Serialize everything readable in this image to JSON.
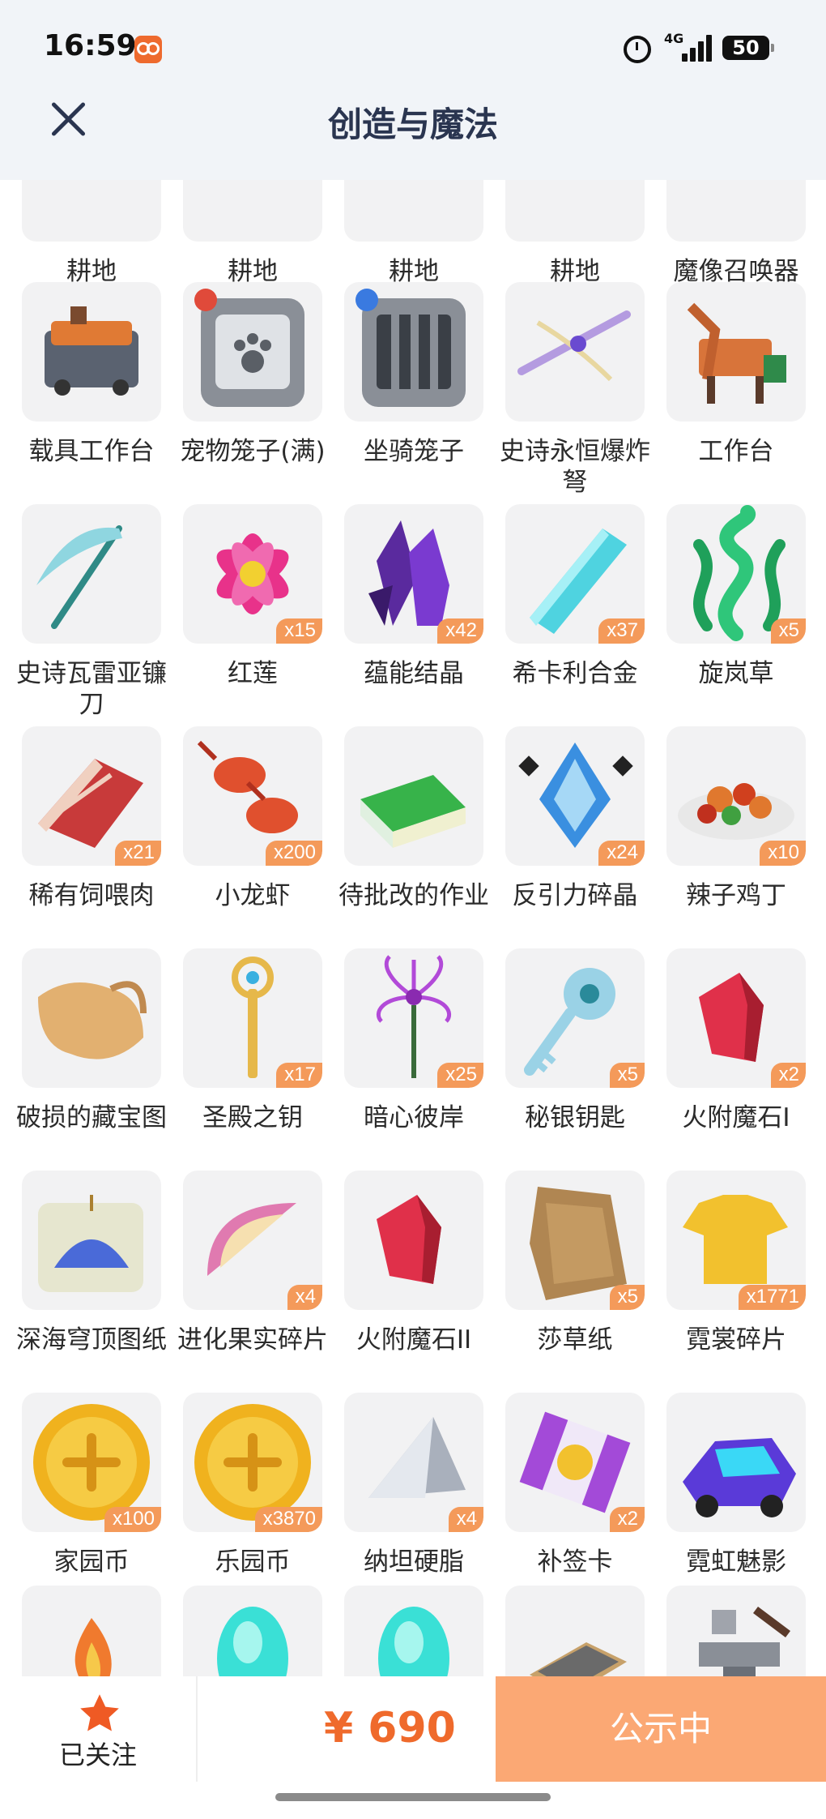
{
  "status_bar": {
    "time": "16:59",
    "network": "4G",
    "battery": "50"
  },
  "header": {
    "title": "创造与魔法"
  },
  "grid": {
    "items": [
      {
        "label": "耕地",
        "count": "",
        "icon": "farmland-icon",
        "color": "#7a4a2e"
      },
      {
        "label": "耕地",
        "count": "",
        "icon": "farmland-icon",
        "color": "#7a4a2e"
      },
      {
        "label": "耕地",
        "count": "",
        "icon": "farmland-icon",
        "color": "#7a4a2e"
      },
      {
        "label": "耕地",
        "count": "",
        "icon": "farmland-icon",
        "color": "#7a4a2e"
      },
      {
        "label": "魔像召唤器",
        "count": "",
        "icon": "golem-summoner-icon",
        "color": "#d8a640"
      },
      {
        "label": "载具工作台",
        "count": "",
        "icon": "vehicle-workbench-icon",
        "color": "#e07a34"
      },
      {
        "label": "宠物笼子(满)",
        "count": "",
        "icon": "pet-cage-icon",
        "color": "#8a8f97"
      },
      {
        "label": "坐骑笼子",
        "count": "",
        "icon": "mount-cage-icon",
        "color": "#8a8f97"
      },
      {
        "label": "史诗永恒爆炸弩",
        "count": "",
        "icon": "crossbow-icon",
        "color": "#b49be0"
      },
      {
        "label": "工作台",
        "count": "",
        "icon": "workbench-icon",
        "color": "#d8743a"
      },
      {
        "label": "史诗瓦雷亚镰刀",
        "count": "",
        "icon": "scythe-icon",
        "color": "#8fd6e0"
      },
      {
        "label": "红莲",
        "count": "x15",
        "icon": "lotus-icon",
        "color": "#e8328a"
      },
      {
        "label": "蕴能结晶",
        "count": "x42",
        "icon": "crystal-icon",
        "color": "#5a2a9e"
      },
      {
        "label": "希卡利合金",
        "count": "x37",
        "icon": "alloy-icon",
        "color": "#4fd3e0"
      },
      {
        "label": "旋岚草",
        "count": "x5",
        "icon": "herb-icon",
        "color": "#2fc67a"
      },
      {
        "label": "稀有饲喂肉",
        "count": "x21",
        "icon": "meat-icon",
        "color": "#c83a3a"
      },
      {
        "label": "小龙虾",
        "count": "x200",
        "icon": "crayfish-icon",
        "color": "#e0502e"
      },
      {
        "label": "待批改的作业",
        "count": "",
        "icon": "homework-icon",
        "color": "#37b34a"
      },
      {
        "label": "反引力碎晶",
        "count": "x24",
        "icon": "antigravity-shard-icon",
        "color": "#3a8fe0"
      },
      {
        "label": "辣子鸡丁",
        "count": "x10",
        "icon": "spicy-chicken-icon",
        "color": "#e0782e"
      },
      {
        "label": "破损的藏宝图",
        "count": "",
        "icon": "treasure-map-icon",
        "color": "#e2b070"
      },
      {
        "label": "圣殿之钥",
        "count": "x17",
        "icon": "temple-key-icon",
        "color": "#e6b84a"
      },
      {
        "label": "暗心彼岸",
        "count": "x25",
        "icon": "spider-lily-icon",
        "color": "#b24ad8"
      },
      {
        "label": "秘银钥匙",
        "count": "x5",
        "icon": "mithril-key-icon",
        "color": "#9ad2e6"
      },
      {
        "label": "火附魔石I",
        "count": "x2",
        "icon": "fire-stone-icon",
        "color": "#e0304a"
      },
      {
        "label": "深海穹顶图纸",
        "count": "",
        "icon": "blueprint-icon",
        "color": "#4a6ad8"
      },
      {
        "label": "进化果实碎片",
        "count": "x4",
        "icon": "fruit-shard-icon",
        "color": "#e07ab0"
      },
      {
        "label": "火附魔石II",
        "count": "",
        "icon": "fire-stone-icon",
        "color": "#e0304a"
      },
      {
        "label": "莎草纸",
        "count": "x5",
        "icon": "papyrus-icon",
        "color": "#b08652"
      },
      {
        "label": "霓裳碎片",
        "count": "x1771",
        "icon": "tshirt-icon",
        "color": "#f2c12e"
      },
      {
        "label": "家园币",
        "count": "x100",
        "icon": "home-coin-icon",
        "color": "#f0b21e"
      },
      {
        "label": "乐园币",
        "count": "x3870",
        "icon": "paradise-coin-icon",
        "color": "#f0b21e"
      },
      {
        "label": "纳坦硬脂",
        "count": "x4",
        "icon": "resin-icon",
        "color": "#a9b0bc"
      },
      {
        "label": "补签卡",
        "count": "x2",
        "icon": "sign-card-icon",
        "color": "#a34ad8"
      },
      {
        "label": "霓虹魅影",
        "count": "",
        "icon": "neon-car-icon",
        "color": "#5a3ad8"
      },
      {
        "label": "",
        "count": "",
        "icon": "campfire-icon",
        "color": "#f07a2e"
      },
      {
        "label": "",
        "count": "",
        "icon": "cyan-gem-icon",
        "color": "#3ae0d6"
      },
      {
        "label": "",
        "count": "",
        "icon": "cyan-gem-icon",
        "color": "#3ae0d6"
      },
      {
        "label": "",
        "count": "",
        "icon": "plate-icon",
        "color": "#6a6a6a"
      },
      {
        "label": "",
        "count": "",
        "icon": "anvil-icon",
        "color": "#8a8f97"
      }
    ]
  },
  "bottom_bar": {
    "follow_label": "已关注",
    "price": "¥ 690",
    "status_button": "公示中"
  },
  "colors": {
    "accent": "#ef6a2c",
    "button": "#fba874",
    "header_bg": "#f1f4f8",
    "title": "#2a3550"
  }
}
